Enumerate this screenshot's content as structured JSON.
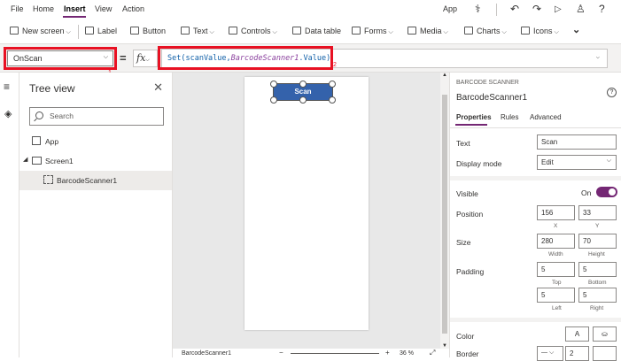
{
  "menubar": {
    "items": [
      "File",
      "Home",
      "Insert",
      "View",
      "Action"
    ],
    "active": "Insert",
    "app_label": "App"
  },
  "ribbon": {
    "new_screen": "New screen",
    "label": "Label",
    "button": "Button",
    "text": "Text",
    "controls": "Controls",
    "data_table": "Data table",
    "forms": "Forms",
    "media": "Media",
    "charts": "Charts",
    "icons": "Icons"
  },
  "formula_bar": {
    "property": "OnScan",
    "marker1": "1",
    "marker2": "2",
    "fx": "fx",
    "formula_fn": "Set(scanValue,",
    "formula_ref": "BarcodeScanner1",
    "formula_tail": ".Value)"
  },
  "tree_view": {
    "title": "Tree view",
    "search_placeholder": "Search",
    "items": [
      {
        "label": "App"
      },
      {
        "label": "Screen1"
      },
      {
        "label": "BarcodeScanner1"
      }
    ]
  },
  "canvas": {
    "scan_button_text": "Scan",
    "status_control": "BarcodeScanner1",
    "zoom": "36 %"
  },
  "properties": {
    "section_title": "BARCODE SCANNER",
    "control_name": "BarcodeScanner1",
    "tabs": [
      "Properties",
      "Rules",
      "Advanced"
    ],
    "text_label": "Text",
    "text_value": "Scan",
    "display_mode_label": "Display mode",
    "display_mode_value": "Edit",
    "visible_label": "Visible",
    "visible_value": "On",
    "position_label": "Position",
    "pos_x": "156",
    "pos_y": "33",
    "x_label": "X",
    "y_label": "Y",
    "size_label": "Size",
    "width": "280",
    "height": "70",
    "width_label": "Width",
    "height_label": "Height",
    "padding_label": "Padding",
    "pad_top": "5",
    "pad_bottom": "5",
    "pad_left": "5",
    "pad_right": "5",
    "top_label": "Top",
    "bottom_label": "Bottom",
    "left_label": "Left",
    "right_label": "Right",
    "color_label": "Color",
    "color_a": "A",
    "border_label": "Border",
    "border_width": "2"
  },
  "colors": {
    "accent": "#742774",
    "button_blue": "#3462ab",
    "highlight_red": "#e81123"
  }
}
